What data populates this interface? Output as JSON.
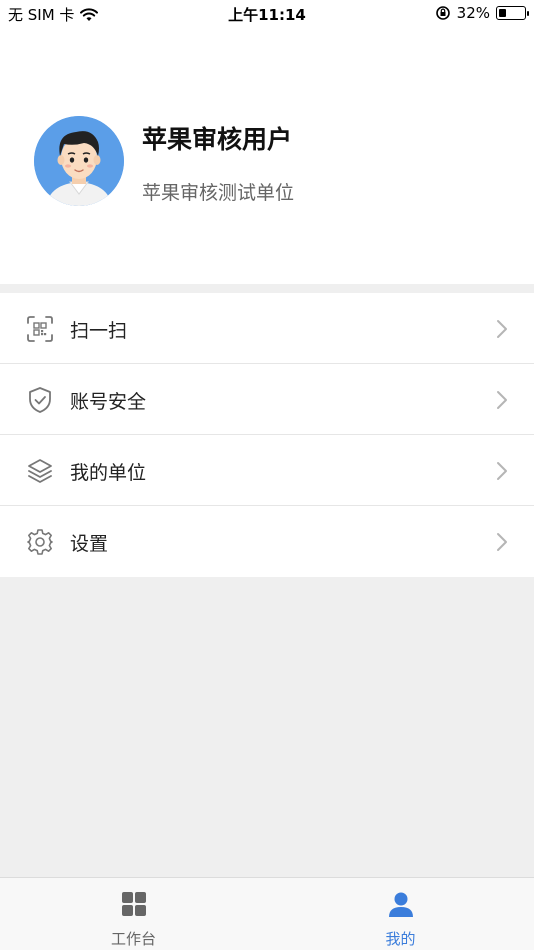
{
  "status_bar": {
    "carrier": "无 SIM 卡",
    "time": "上午11:14",
    "battery_percent": "32%",
    "battery_level": 0.32,
    "icons": [
      "wifi-icon",
      "orientation-lock-icon",
      "battery-icon"
    ]
  },
  "profile": {
    "name": "苹果审核用户",
    "organization": "苹果审核测试单位",
    "avatar_bg": "#5b9ee8"
  },
  "menu": {
    "items": [
      {
        "label": "扫一扫",
        "icon": "scan-icon"
      },
      {
        "label": "账号安全",
        "icon": "shield-icon"
      },
      {
        "label": "我的单位",
        "icon": "layers-icon"
      },
      {
        "label": "设置",
        "icon": "gear-icon"
      }
    ]
  },
  "tab_bar": {
    "tabs": [
      {
        "label": "工作台",
        "icon": "grid-icon",
        "active": false
      },
      {
        "label": "我的",
        "icon": "user-icon",
        "active": true
      }
    ],
    "active_color": "#3b7ddb",
    "inactive_color": "#666666"
  }
}
